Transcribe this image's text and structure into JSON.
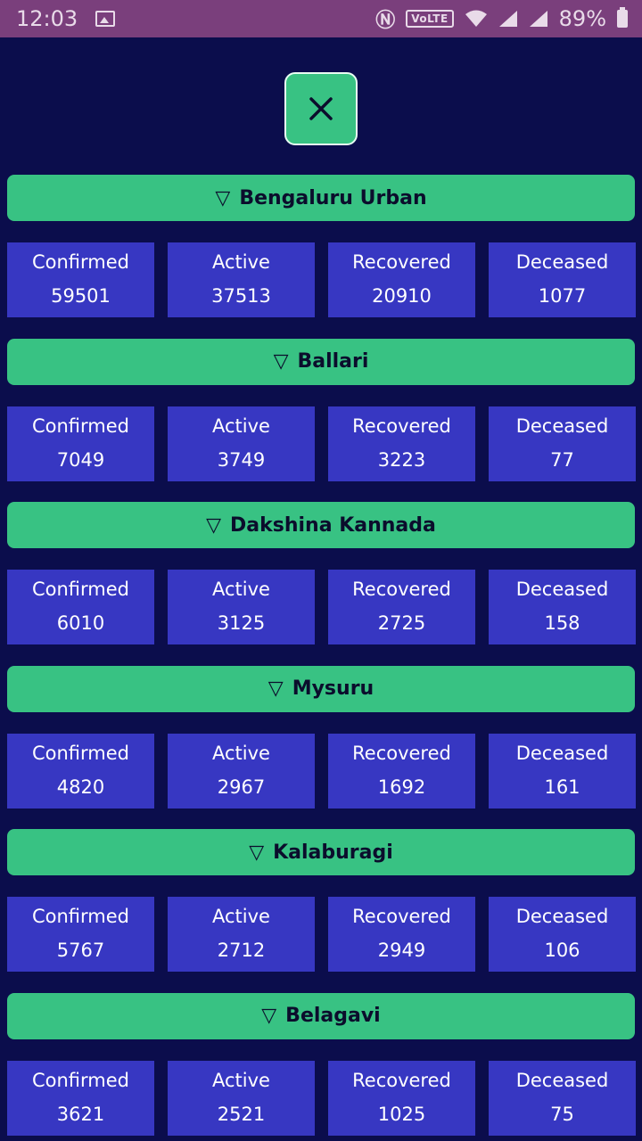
{
  "status_bar": {
    "time": "12:03",
    "volte": "VoLTE",
    "battery": "89%"
  },
  "close_button": {
    "icon": "close-icon"
  },
  "stat_labels": [
    "Confirmed",
    "Active",
    "Recovered",
    "Deceased"
  ],
  "districts": [
    {
      "name": "Bengaluru Urban",
      "confirmed": "59501",
      "active": "37513",
      "recovered": "20910",
      "deceased": "1077"
    },
    {
      "name": "Ballari",
      "confirmed": "7049",
      "active": "3749",
      "recovered": "3223",
      "deceased": "77"
    },
    {
      "name": "Dakshina Kannada",
      "confirmed": "6010",
      "active": "3125",
      "recovered": "2725",
      "deceased": "158"
    },
    {
      "name": "Mysuru",
      "confirmed": "4820",
      "active": "2967",
      "recovered": "1692",
      "deceased": "161"
    },
    {
      "name": "Kalaburagi",
      "confirmed": "5767",
      "active": "2712",
      "recovered": "2949",
      "deceased": "106"
    },
    {
      "name": "Belagavi",
      "confirmed": "3621",
      "active": "2521",
      "recovered": "1025",
      "deceased": "75"
    }
  ],
  "colors": {
    "background": "#0b0d4c",
    "status_bar": "#7a3f7c",
    "header_green": "#38c283",
    "stat_blue": "#3737c2"
  }
}
